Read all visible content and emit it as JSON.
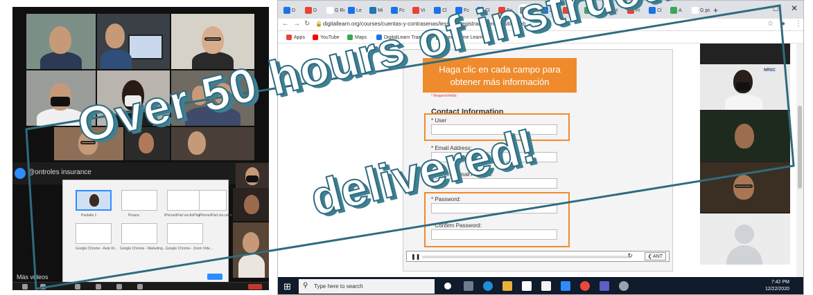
{
  "headline": {
    "line1": "Over 50 hours of instruction",
    "line2": "delivered!"
  },
  "colors": {
    "frame": "#2e6c80",
    "accent_orange": "#ef8b2c",
    "taskbar": "#101b2b",
    "zoom_blue": "#2d8cff"
  },
  "video_call": {
    "meeting_name": "@ontroles insurance",
    "mas_videos": "Más videos",
    "share_thumbs": [
      {
        "label": "Pantalla 1"
      },
      {
        "label": "Pizarra"
      },
      {
        "label": "iPhone/iPad vía AirPlay"
      },
      {
        "label": "iPhone/iPad vía cable"
      },
      {
        "label": "Google Chrome - Aula Vir..."
      },
      {
        "label": "Google Chrome - Marketing..."
      },
      {
        "label": "Google Chrome - Zoom Vide..."
      }
    ]
  },
  "browser": {
    "tabs": [
      "D",
      "D",
      "G Re",
      "Le",
      "Mi",
      "Fc",
      "Vi",
      "Cl",
      "Fc",
      "Cl",
      "Sy",
      "",
      "Zi",
      "D",
      "Zi",
      "H",
      "Fr",
      "Cl",
      "A",
      "G ps"
    ],
    "new_tab": "+",
    "window_controls": {
      "minimize": "–",
      "maximize": "□",
      "close": "✕"
    },
    "url": "digitallearn.org/courses/cuentas-y-contrasenas/lessons/registrarse-en-un-sitio-web",
    "bookmarks": [
      {
        "label": "Apps",
        "icon": "apps-grid-icon",
        "color": "#e94235"
      },
      {
        "label": "YouTube",
        "icon": "youtube-icon",
        "color": "#ff0000"
      },
      {
        "label": "Maps",
        "icon": "maps-pin-icon",
        "color": "#34a853"
      },
      {
        "label": "DigitalLearn Training",
        "icon": "digitallearn-icon",
        "color": "#1a73e8"
      },
      {
        "label": "Free Online Learnin...",
        "icon": "gcf-icon",
        "color": "#3aa757"
      }
    ],
    "lesson": {
      "banner_line1": "Haga clic en cada campo para",
      "banner_line2": "obtener más información",
      "required_note": "* Required fields",
      "form_title": "Contact Information",
      "fields": [
        {
          "label": "* User",
          "id": "user"
        },
        {
          "label": "* Email Address:",
          "id": "email"
        },
        {
          "label": "* Confirm Email Address:",
          "id": "confirm-email"
        },
        {
          "label": "* Password:",
          "id": "password"
        },
        {
          "label": "* Confirm Password:",
          "id": "confirm-password"
        }
      ],
      "player": {
        "play": "❚❚",
        "reload": "↻",
        "prev": "❮ ANT"
      }
    },
    "gallery_badge": "NRSC"
  },
  "taskbar": {
    "search_placeholder": "Type here to search",
    "time": "7:42 PM",
    "date": "12/22/2020"
  }
}
